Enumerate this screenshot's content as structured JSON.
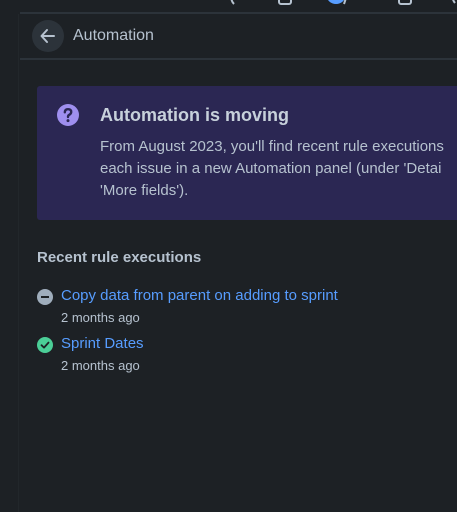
{
  "header": {
    "back_icon": "arrow-left-icon",
    "title": "Automation"
  },
  "banner": {
    "icon": "question-circle-icon",
    "title": "Automation is moving",
    "lines": [
      "From August 2023, you'll find recent rule executions",
      "each issue in a new Automation panel (under 'Detai",
      "'More fields')."
    ]
  },
  "recent": {
    "title": "Recent rule executions",
    "items": [
      {
        "name": "Copy data from parent on adding to sprint",
        "time": "2 months ago",
        "status": "no-actions",
        "icon": "minus-circle-icon"
      },
      {
        "name": "Sprint Dates",
        "time": "2 months ago",
        "status": "success",
        "icon": "check-circle-icon"
      }
    ]
  },
  "colors": {
    "background": "#1d2125",
    "banner": "#2b2753",
    "banner_icon": "#9f8fef",
    "link": "#579dff",
    "success": "#4bce97",
    "neutral": "#9fadbc"
  }
}
